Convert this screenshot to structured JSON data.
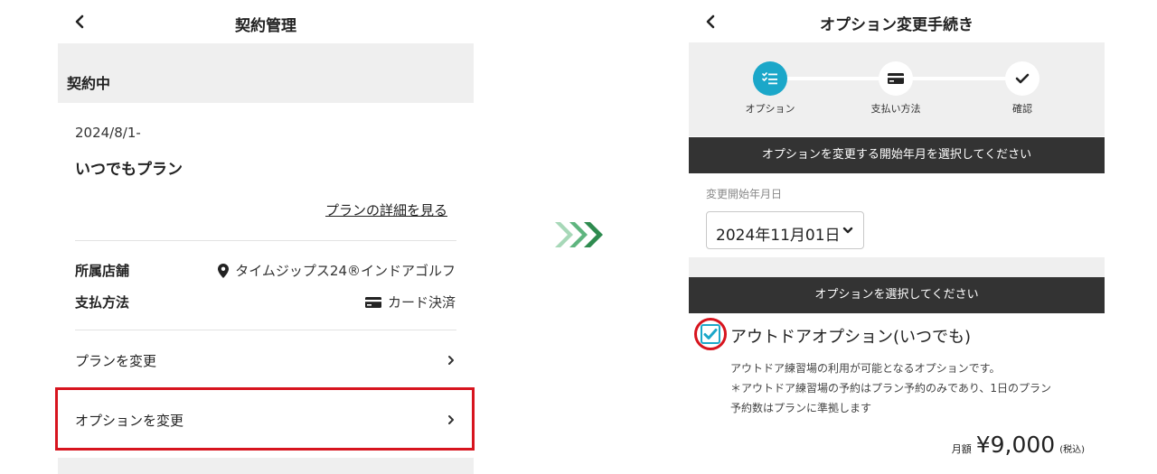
{
  "left": {
    "title": "契約管理",
    "status": "契約中",
    "start_date": "2024/8/1-",
    "plan_name": "いつでもプラン",
    "plan_detail_link": "プランの詳細を見る",
    "store_label": "所属店舗",
    "store_value": "タイムジップス24®インドアゴルフ",
    "payment_label": "支払方法",
    "payment_value": "カード決済",
    "menu": [
      {
        "label": "プランを変更"
      },
      {
        "label": "オプションを変更"
      }
    ],
    "highlight_color": "#d7141e"
  },
  "right": {
    "title": "オプション変更手続き",
    "steps": [
      {
        "label": "オプション",
        "icon": "list-check-icon",
        "active": true
      },
      {
        "label": "支払い方法",
        "icon": "credit-card-icon",
        "active": false
      },
      {
        "label": "確認",
        "icon": "checkmark-icon",
        "active": false
      }
    ],
    "start_bar": "オプションを変更する開始年月を選択してください",
    "field_label": "変更開始年月日",
    "selected_date": "2024年11月01日",
    "option_bar": "オプションを選択してください",
    "option": {
      "title": "アウトドアオプション(いつでも)",
      "checked": true,
      "desc_lines": [
        "アウトドア練習場の利用が可能となるオプションです。",
        "＊アウトドア練習場の予約はプラン予約のみであり、1日のプラン",
        "予約数はプランに準拠します"
      ],
      "price_prefix": "月額",
      "price": "¥9,000",
      "price_suffix": "(税込)"
    },
    "accent_color": "#1ba7c9"
  }
}
